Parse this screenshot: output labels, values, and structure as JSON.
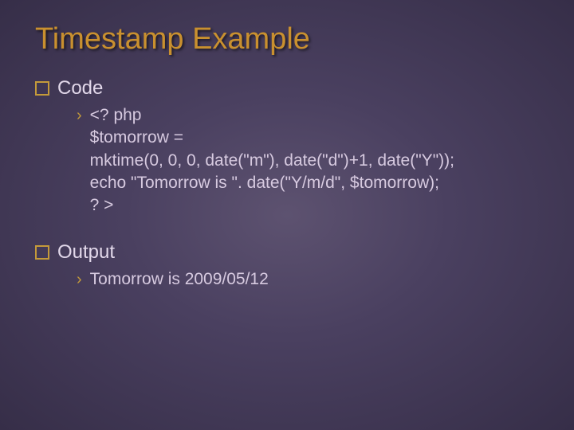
{
  "title": "Timestamp Example",
  "sections": [
    {
      "label": "Code",
      "body": "<? php\n$tomorrow =\nmktime(0, 0, 0, date(\"m\"), date(\"d\")+1, date(\"Y\"));\necho \"Tomorrow is \". date(\"Y/m/d\", $tomorrow);\n? >"
    },
    {
      "label": "Output",
      "body": "Tomorrow is 2009/05/12"
    }
  ]
}
